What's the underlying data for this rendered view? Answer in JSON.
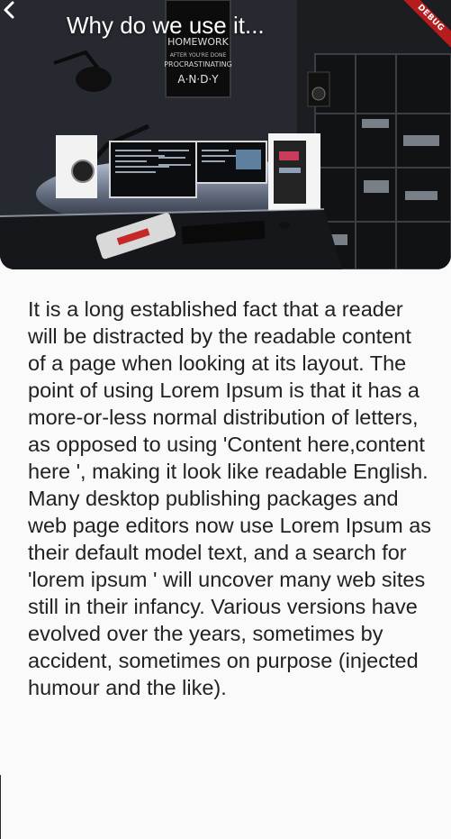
{
  "app_bar": {
    "title": "Why do we use it...",
    "back_icon": "chevron-left-icon"
  },
  "hero": {
    "poster_text": [
      "HOMEWORK",
      "AFTER YOU'RE DONE",
      "PROCRASTINATING",
      "A·N·D·Y"
    ]
  },
  "debug_banner": "DEBUG",
  "article": {
    "body": "It is a long established fact that a reader will be distracted by the readable content of a page when looking at its layout. The point of using Lorem Ipsum is that it has a more-or-less normal distribution of letters, as opposed to using 'Content here,content here ', making it look like readable English. Many desktop publishing packages and web page editors now use Lorem Ipsum as their default model text, and a search for 'lorem ipsum ' will uncover many web sites still in their infancy. Various versions have evolved over the years, sometimes by accident, sometimes on purpose (injected humour and the like)."
  },
  "colors": {
    "background": "#fafafa",
    "text": "#222222",
    "debug_banner": "#b71c1c"
  }
}
